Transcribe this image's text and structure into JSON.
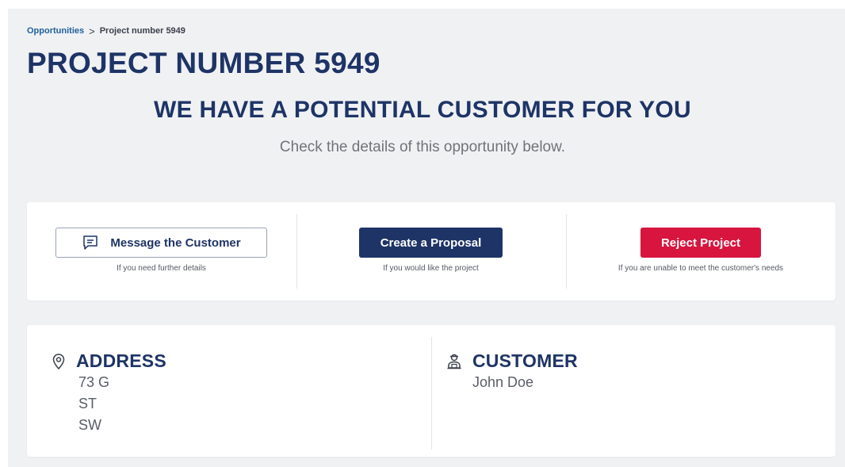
{
  "breadcrumb": {
    "parent": "Opportunities",
    "separator": ">",
    "current": "Project number 5949"
  },
  "page_title": "PROJECT NUMBER 5949",
  "hero": {
    "heading": "WE HAVE A POTENTIAL CUSTOMER FOR YOU",
    "subheading": "Check the details of this opportunity below."
  },
  "actions": {
    "message": {
      "label": "Message the Customer",
      "hint": "If you need further details",
      "icon": "chat-icon"
    },
    "proposal": {
      "label": "Create a Proposal",
      "hint": "If you would like the project"
    },
    "reject": {
      "label": "Reject Project",
      "hint": "If you are unable to meet the customer's needs"
    }
  },
  "details": {
    "address": {
      "title": "ADDRESS",
      "icon": "location-pin-icon",
      "lines": [
        "73 G",
        "ST",
        "SW"
      ]
    },
    "customer": {
      "title": "CUSTOMER",
      "icon": "customer-icon",
      "name": "John Doe"
    }
  },
  "colors": {
    "brand_navy": "#1e3466",
    "danger_red": "#d7153f",
    "link_blue": "#1f5f9c",
    "background": "#f0f1f3"
  }
}
